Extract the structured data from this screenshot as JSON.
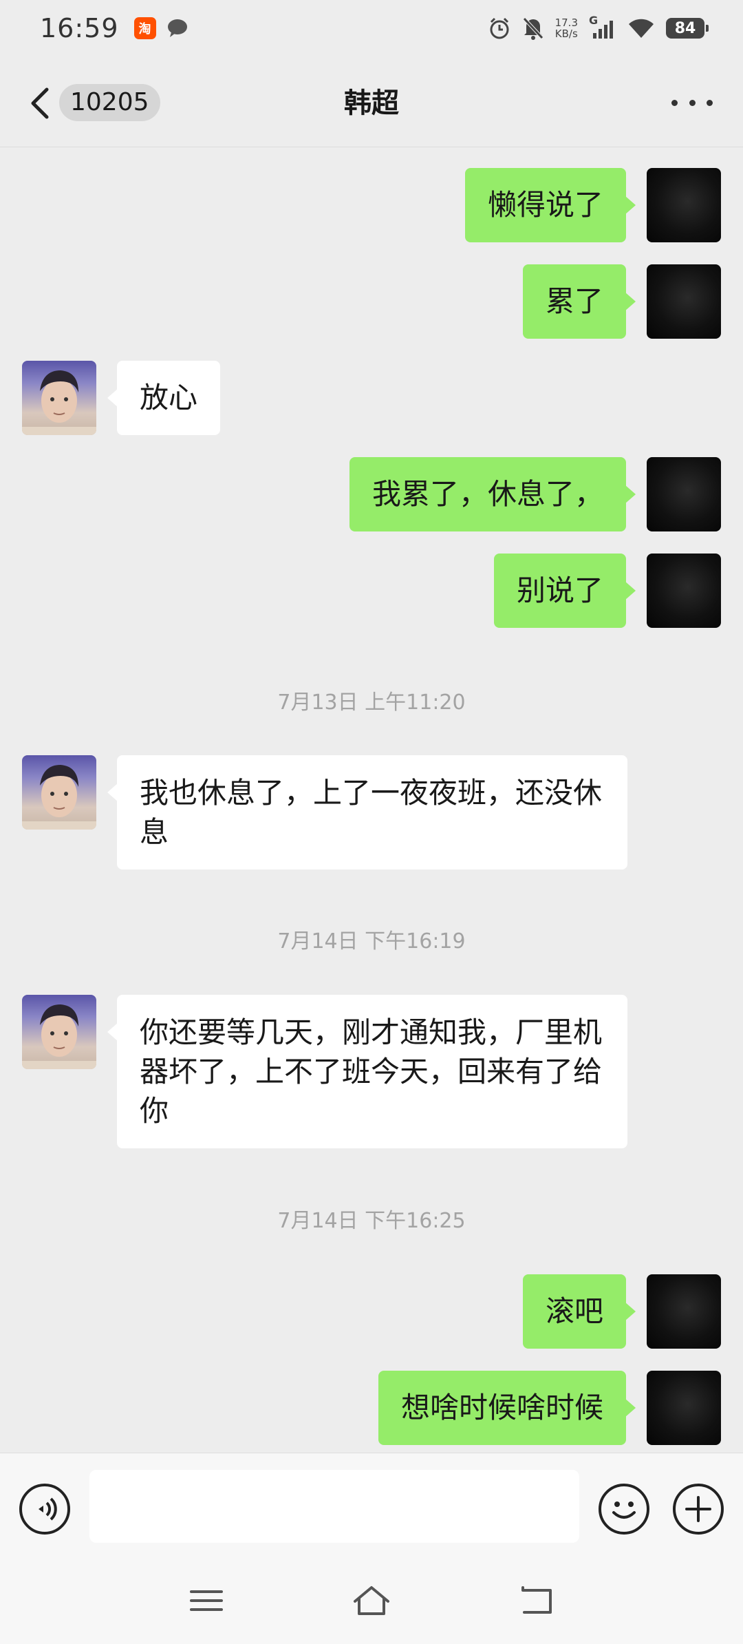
{
  "status_bar": {
    "time": "16:59",
    "network_speed_value": "17.3",
    "network_speed_unit": "KB/s",
    "signal_label": "G",
    "battery": "84",
    "icons": [
      "taobao-icon",
      "message-icon",
      "alarm-icon",
      "mute-icon",
      "signal-icon",
      "wifi-icon",
      "battery-icon"
    ]
  },
  "header": {
    "unread_count": "10205",
    "title": "韩超"
  },
  "messages": [
    {
      "side": "out",
      "text": "懒得说了"
    },
    {
      "side": "out",
      "text": "累了"
    },
    {
      "side": "in",
      "text": "放心"
    },
    {
      "side": "out",
      "text": "我累了，休息了，"
    },
    {
      "side": "out",
      "text": "别说了"
    },
    {
      "time": "7月13日 上午11:20"
    },
    {
      "side": "in",
      "text": "我也休息了，上了一夜夜班，还没休息"
    },
    {
      "time": "7月14日 下午16:19"
    },
    {
      "side": "in",
      "text": "你还要等几天，刚才通知我，厂里机器坏了，上不了班今天，回来有了给你"
    },
    {
      "time": "7月14日 下午16:25"
    },
    {
      "side": "out",
      "text": "滚吧"
    },
    {
      "side": "out",
      "text": "想啥时候啥时候"
    }
  ],
  "colors": {
    "background": "#ededed",
    "outgoing_bubble": "#95ec69",
    "incoming_bubble": "#ffffff",
    "timestamp": "#a3a3a3"
  }
}
